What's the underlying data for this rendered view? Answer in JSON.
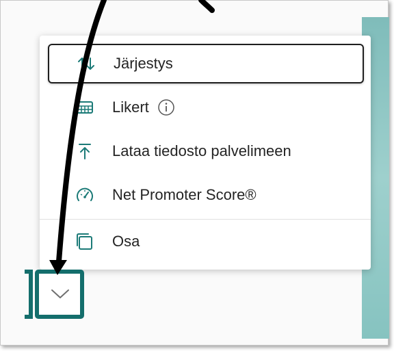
{
  "menu": {
    "items": [
      {
        "label": "Järjestys",
        "icon": "sort-arrows-icon",
        "selected": true
      },
      {
        "label": "Likert",
        "icon": "likert-grid-icon",
        "info_icon": "info-icon"
      },
      {
        "label": "Lataa tiedosto palvelimeen",
        "icon": "upload-icon"
      },
      {
        "label": "Net Promoter Score®",
        "icon": "gauge-icon"
      },
      {
        "label": "Osa",
        "icon": "section-icon"
      }
    ]
  },
  "colors": {
    "accent_teal": "#146e6c",
    "menu_icon_teal": "#1b7a77",
    "annotation_arrow": "#000000"
  },
  "annotation": {
    "type": "curved-arrow",
    "target": "dropdown-button"
  }
}
